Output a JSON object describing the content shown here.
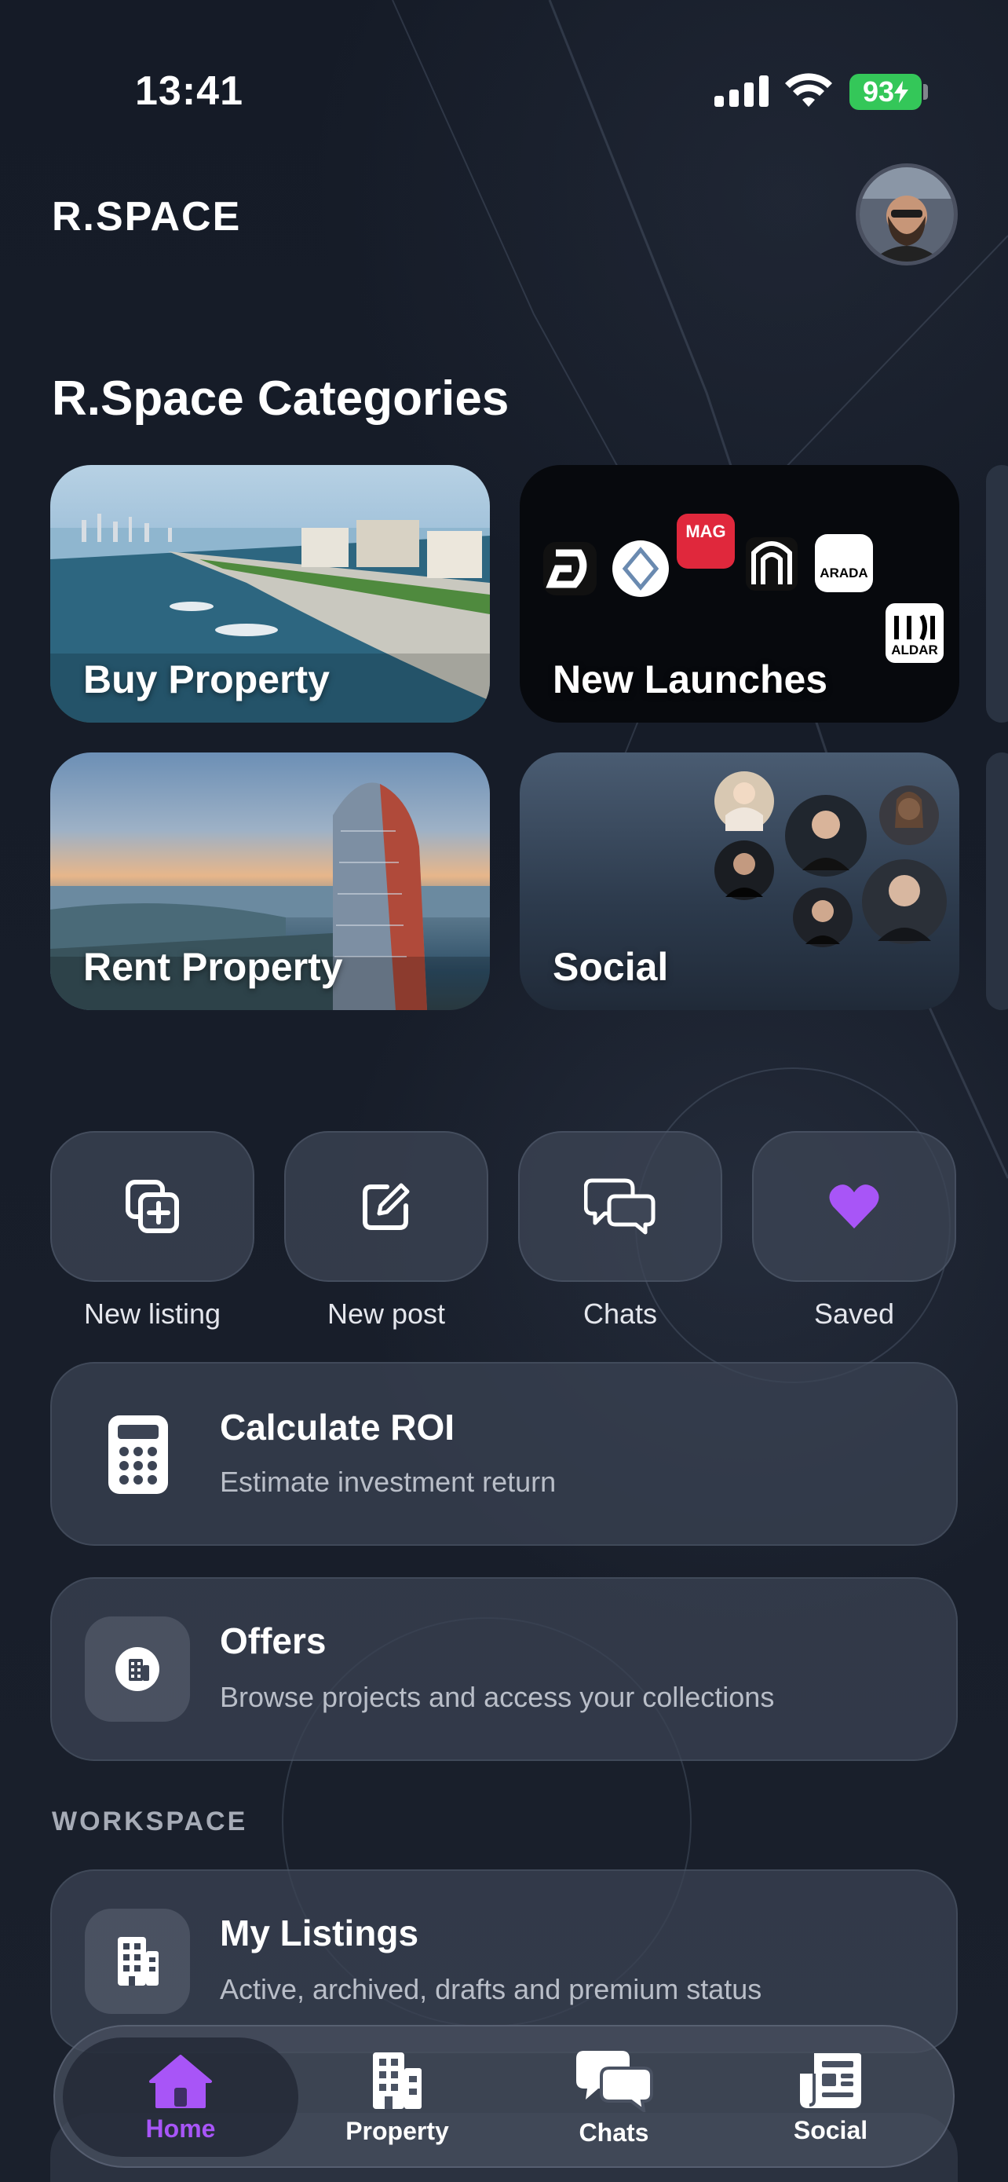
{
  "status_bar": {
    "time": "13:41",
    "battery": "93"
  },
  "header": {
    "logo": "R.SPACE"
  },
  "categories": {
    "title": "R.Space Categories",
    "items": [
      {
        "label": "Buy Property"
      },
      {
        "label": "New Launches"
      },
      {
        "label": "Rent Property"
      },
      {
        "label": "Social"
      }
    ],
    "launch_logos": [
      "MAG",
      "ARADA",
      "ALDAR"
    ]
  },
  "quick_actions": [
    {
      "label": "New listing",
      "icon": "add-copy-icon"
    },
    {
      "label": "New post",
      "icon": "edit-icon"
    },
    {
      "label": "Chats",
      "icon": "chat-bubbles-icon"
    },
    {
      "label": "Saved",
      "icon": "heart-icon"
    }
  ],
  "cards": {
    "roi": {
      "title": "Calculate ROI",
      "subtitle": "Estimate investment return"
    },
    "offers": {
      "title": "Offers",
      "subtitle": "Browse projects and access your collections"
    }
  },
  "workspace": {
    "heading": "WORKSPACE",
    "my_listings": {
      "title": "My Listings",
      "subtitle": "Active, archived, drafts and premium status"
    }
  },
  "tab_bar": {
    "tabs": [
      {
        "label": "Home",
        "active": true
      },
      {
        "label": "Property",
        "active": false
      },
      {
        "label": "Chats",
        "active": false
      },
      {
        "label": "Social",
        "active": false
      }
    ]
  },
  "colors": {
    "accent": "#a855f7",
    "background": "#141a26",
    "battery": "#34c759"
  }
}
